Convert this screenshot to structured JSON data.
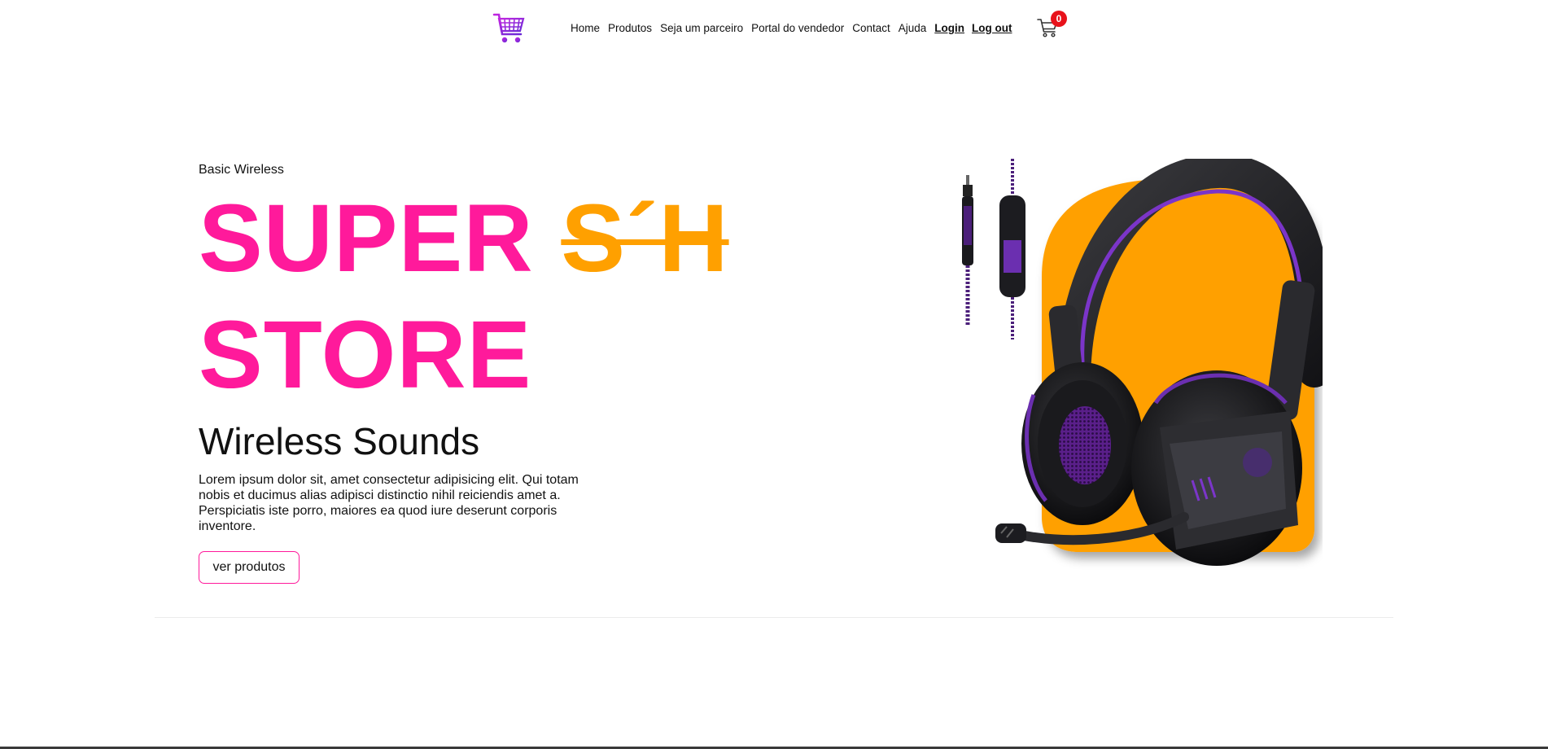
{
  "header": {
    "nav": [
      {
        "label": "Home"
      },
      {
        "label": "Produtos"
      },
      {
        "label": "Seja um parceiro"
      },
      {
        "label": "Portal do vendedor"
      },
      {
        "label": "Contact"
      },
      {
        "label": "Ajuda"
      },
      {
        "label": "Login"
      },
      {
        "label": "Log out"
      }
    ],
    "cart_count": "0",
    "logo_icon": "shopping-cart-logo",
    "cart_icon": "cart-icon"
  },
  "hero": {
    "subtitle": "Basic Wireless",
    "headline_main": "SUPER",
    "headline_accent": "S´H",
    "headline_line2": "STORE",
    "tagline": "Wireless Sounds",
    "description": "Lorem ipsum dolor sit, amet consectetur adipisicing elit. Qui totam nobis et ducimus alias adipisci distinctio nihil reiciendis amet a. Perspiciatis iste porro, maiores ea quod iure deserunt corporis inventore.",
    "button_label": "ver produtos"
  },
  "colors": {
    "brand_pink": "#ff1a9b",
    "accent_orange": "#ffa000",
    "badge_red": "#e8121b",
    "logo_purple": "#9b30d9"
  }
}
